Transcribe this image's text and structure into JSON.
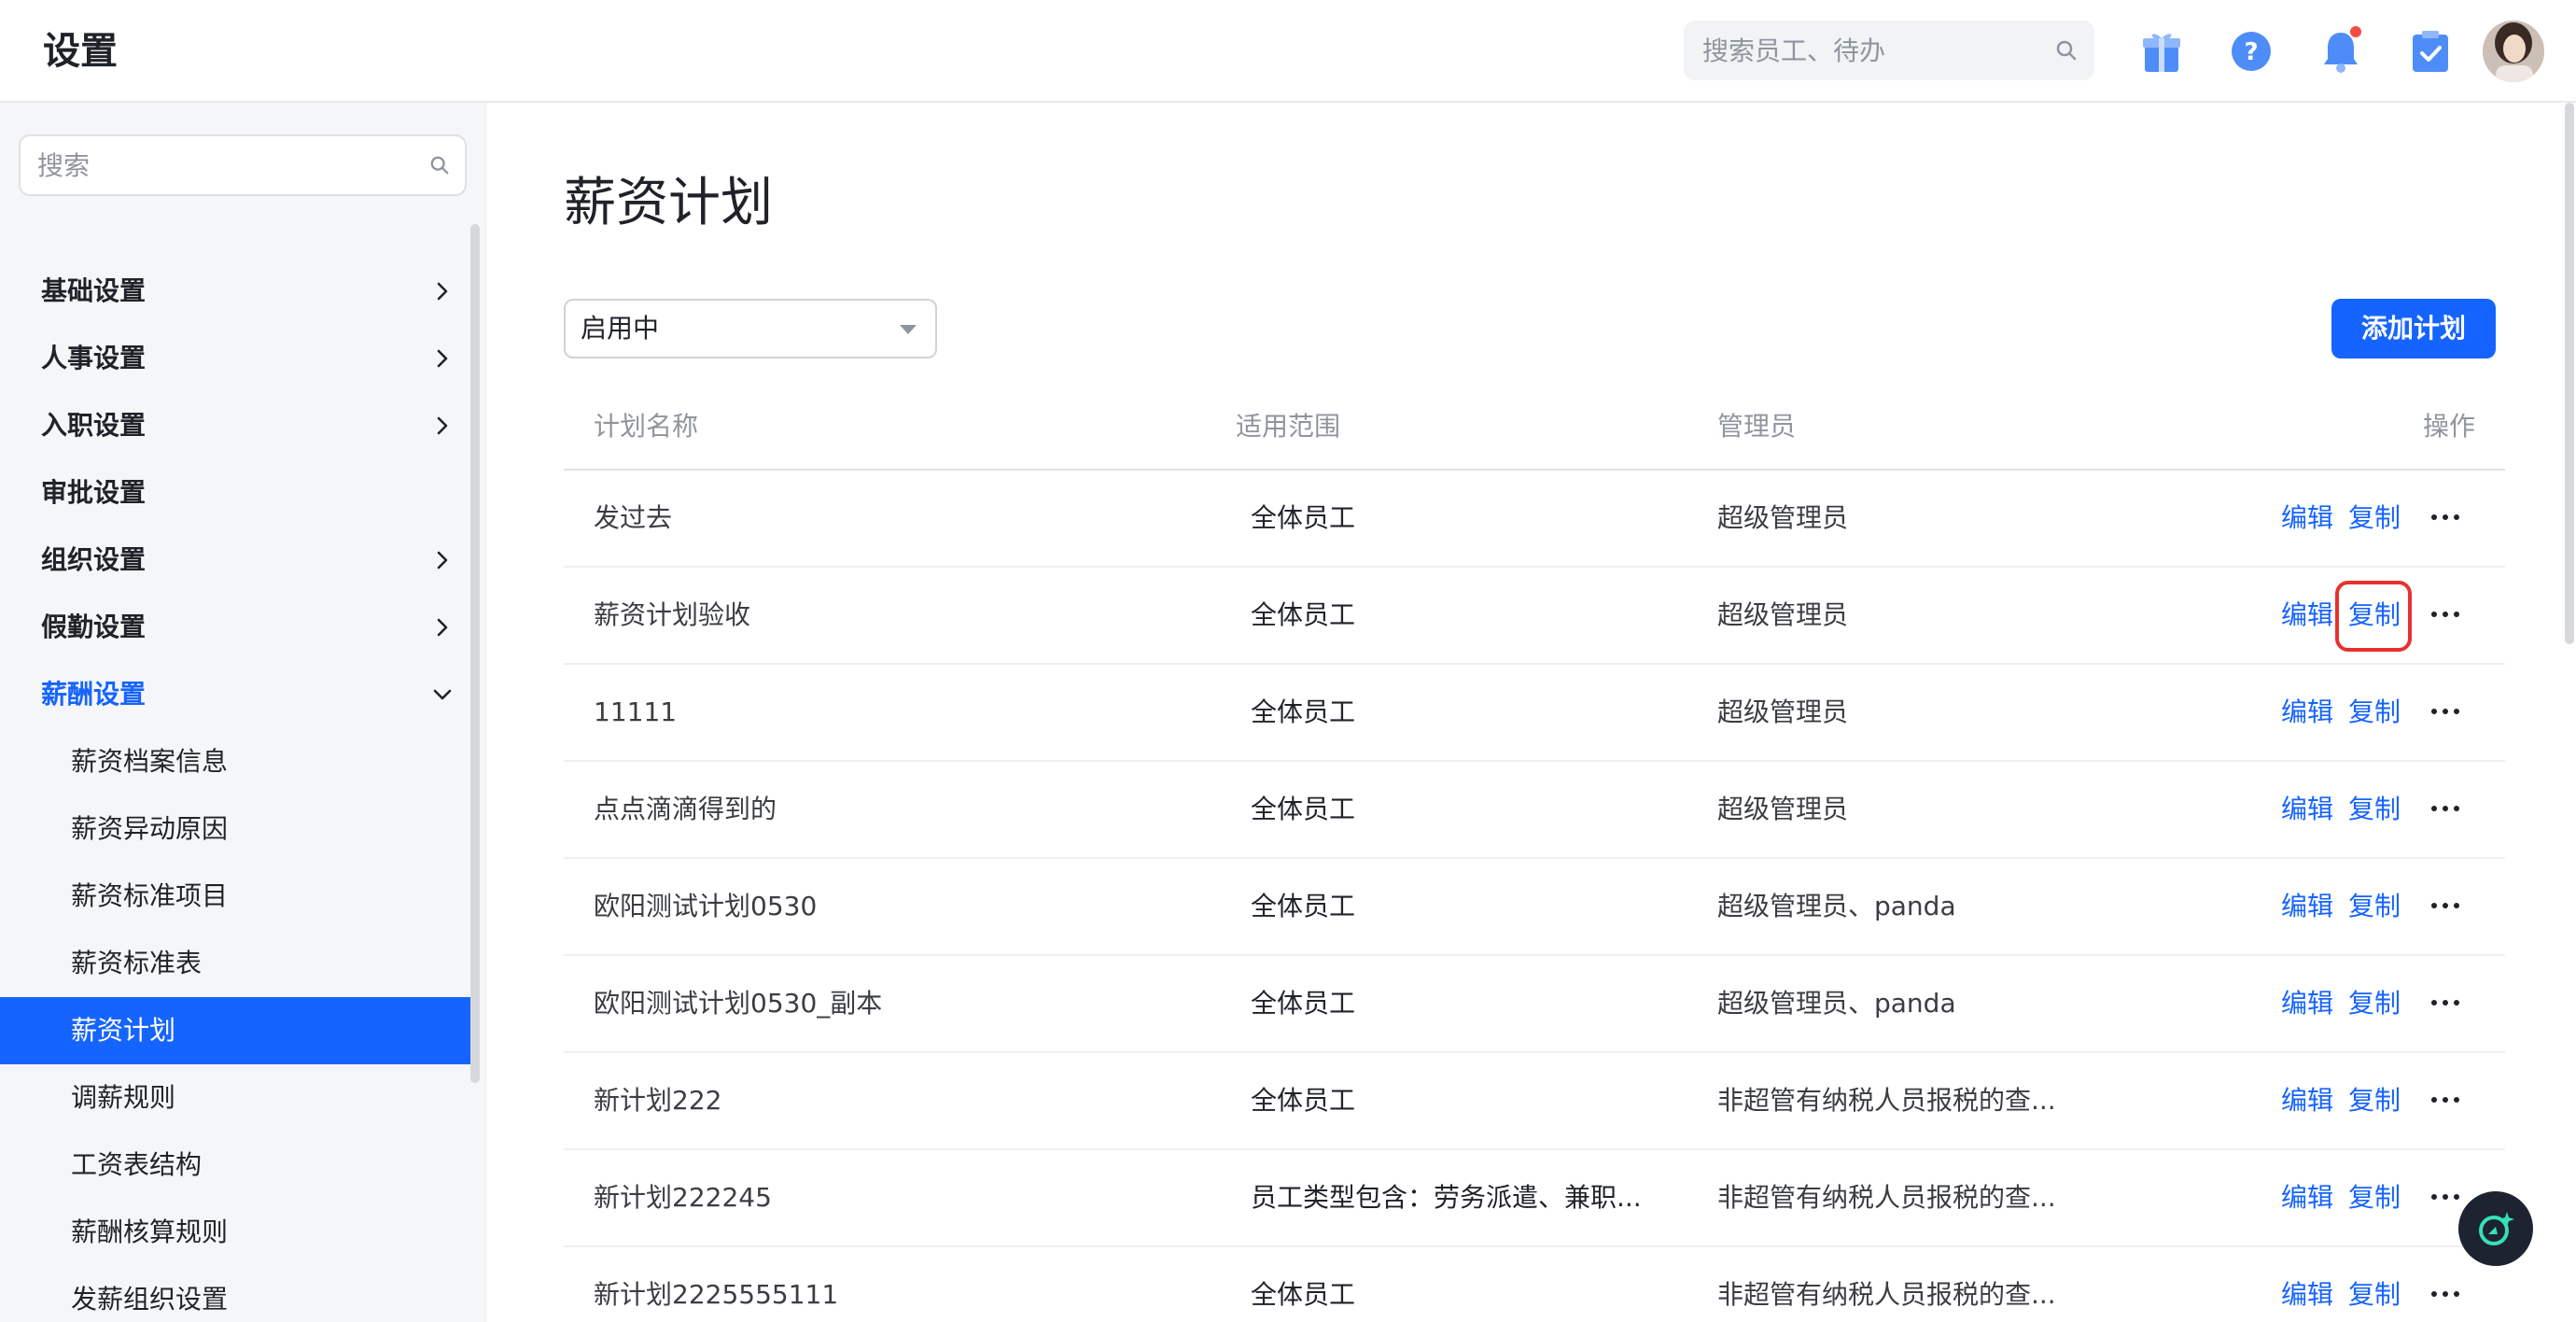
{
  "header": {
    "title": "设置",
    "search_placeholder": "搜索员工、待办",
    "icons": [
      "gift-icon",
      "help-icon",
      "bell-icon",
      "tasks-icon"
    ],
    "has_notification": true
  },
  "sidebar": {
    "search_placeholder": "搜索",
    "items": [
      {
        "label": "基础设置",
        "expandable": true
      },
      {
        "label": "人事设置",
        "expandable": true
      },
      {
        "label": "入职设置",
        "expandable": true
      },
      {
        "label": "审批设置",
        "expandable": false
      },
      {
        "label": "组织设置",
        "expandable": true
      },
      {
        "label": "假勤设置",
        "expandable": true
      },
      {
        "label": "薪酬设置",
        "expandable": true,
        "expanded": true
      }
    ],
    "sub_items": [
      {
        "label": "薪资档案信息"
      },
      {
        "label": "薪资异动原因"
      },
      {
        "label": "薪资标准项目"
      },
      {
        "label": "薪资标准表"
      },
      {
        "label": "薪资计划",
        "selected": true
      },
      {
        "label": "调薪规则"
      },
      {
        "label": "工资表结构"
      },
      {
        "label": "薪酬核算规则"
      },
      {
        "label": "发薪组织设置"
      }
    ]
  },
  "main": {
    "title": "薪资计划",
    "status_filter": "启用中",
    "add_button": "添加计划",
    "columns": {
      "name": "计划名称",
      "scope": "适用范围",
      "admin": "管理员",
      "actions": "操作"
    },
    "edit_label": "编辑",
    "copy_label": "复制",
    "rows": [
      {
        "name": "发过去",
        "scope": "全体员工",
        "admin": "超级管理员"
      },
      {
        "name": "薪资计划验收",
        "scope": "全体员工",
        "admin": "超级管理员",
        "highlight_copy": true
      },
      {
        "name": "11111",
        "scope": "全体员工",
        "admin": "超级管理员"
      },
      {
        "name": "点点滴滴得到的",
        "scope": "全体员工",
        "admin": "超级管理员"
      },
      {
        "name": "欧阳测试计划0530",
        "scope": "全体员工",
        "admin": "超级管理员、panda"
      },
      {
        "name": "欧阳测试计划0530_副本",
        "scope": "全体员工",
        "admin": "超级管理员、panda"
      },
      {
        "name": "新计划222",
        "scope": "全体员工",
        "admin": "非超管有纳税人员报税的查..."
      },
      {
        "name": "新计划222245",
        "scope": "员工类型包含：劳务派遣、兼职...",
        "admin": "非超管有纳税人员报税的查..."
      },
      {
        "name": "新计划2225555111",
        "scope": "全体员工",
        "admin": "非超管有纳税人员报税的查..."
      }
    ]
  },
  "colors": {
    "primary": "#1664ff",
    "highlight": "#e8302c",
    "sidebar_bg": "#f5f6f7"
  }
}
